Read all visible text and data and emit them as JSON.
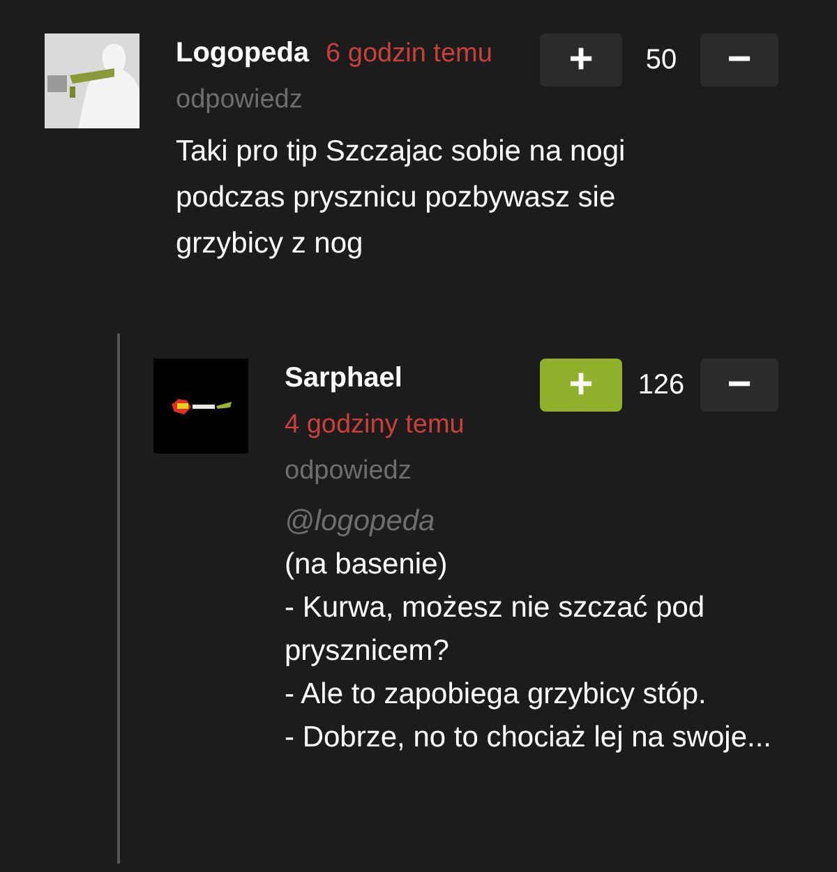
{
  "comments": [
    {
      "author": "Logopeda",
      "time": "6 godzin temu",
      "reply": "odpowiedz",
      "score": "50",
      "plus": "+",
      "minus": "−",
      "upvoted": false,
      "text": "Taki pro tip Szczajac sobie na nogi podczas prysznicu pozbywasz sie grzybicy z nog",
      "children": [
        {
          "author": "Sarphael",
          "time": "4 godziny temu",
          "reply": "odpowiedz",
          "score": "126",
          "plus": "+",
          "minus": "−",
          "upvoted": true,
          "mention": "@logopeda",
          "lines": [
            "(na basenie)",
            "- Kurwa, możesz nie szczać pod prysznicem?",
            "- Ale to zapobiega grzybicy stóp.",
            "- Dobrze, no to chociaż lej na swoje..."
          ]
        }
      ]
    }
  ]
}
